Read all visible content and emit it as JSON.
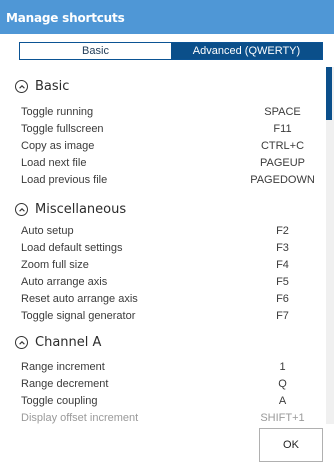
{
  "window": {
    "title": "Manage shortcuts"
  },
  "tabs": [
    {
      "label": "Basic",
      "active": false
    },
    {
      "label": "Advanced (QWERTY)",
      "active": true
    }
  ],
  "sections": [
    {
      "label": "Basic",
      "shortcuts": [
        {
          "name": "Toggle running",
          "key": "SPACE"
        },
        {
          "name": "Toggle fullscreen",
          "key": "F11"
        },
        {
          "name": "Copy as image",
          "key": "CTRL+C"
        },
        {
          "name": "Load next file",
          "key": "PAGEUP"
        },
        {
          "name": "Load previous file",
          "key": "PAGEDOWN"
        }
      ]
    },
    {
      "label": "Miscellaneous",
      "shortcuts": [
        {
          "name": "Auto setup",
          "key": "F2"
        },
        {
          "name": "Load default settings",
          "key": "F3"
        },
        {
          "name": "Zoom full size",
          "key": "F4"
        },
        {
          "name": "Auto arrange axis",
          "key": "F5"
        },
        {
          "name": "Reset auto arrange axis",
          "key": "F6"
        },
        {
          "name": "Toggle signal generator",
          "key": "F7"
        }
      ]
    },
    {
      "label": "Channel A",
      "shortcuts": [
        {
          "name": "Range increment",
          "key": "1"
        },
        {
          "name": "Range decrement",
          "key": "Q"
        },
        {
          "name": "Toggle coupling",
          "key": "A"
        },
        {
          "name": "Display offset increment",
          "key": "SHIFT+1"
        }
      ]
    }
  ],
  "buttons": {
    "ok": "OK"
  },
  "colors": {
    "titlebar": "#4f97d6",
    "accent": "#0b4f8a"
  },
  "icons": {
    "section_toggle": "chevron-up-circle-icon"
  }
}
